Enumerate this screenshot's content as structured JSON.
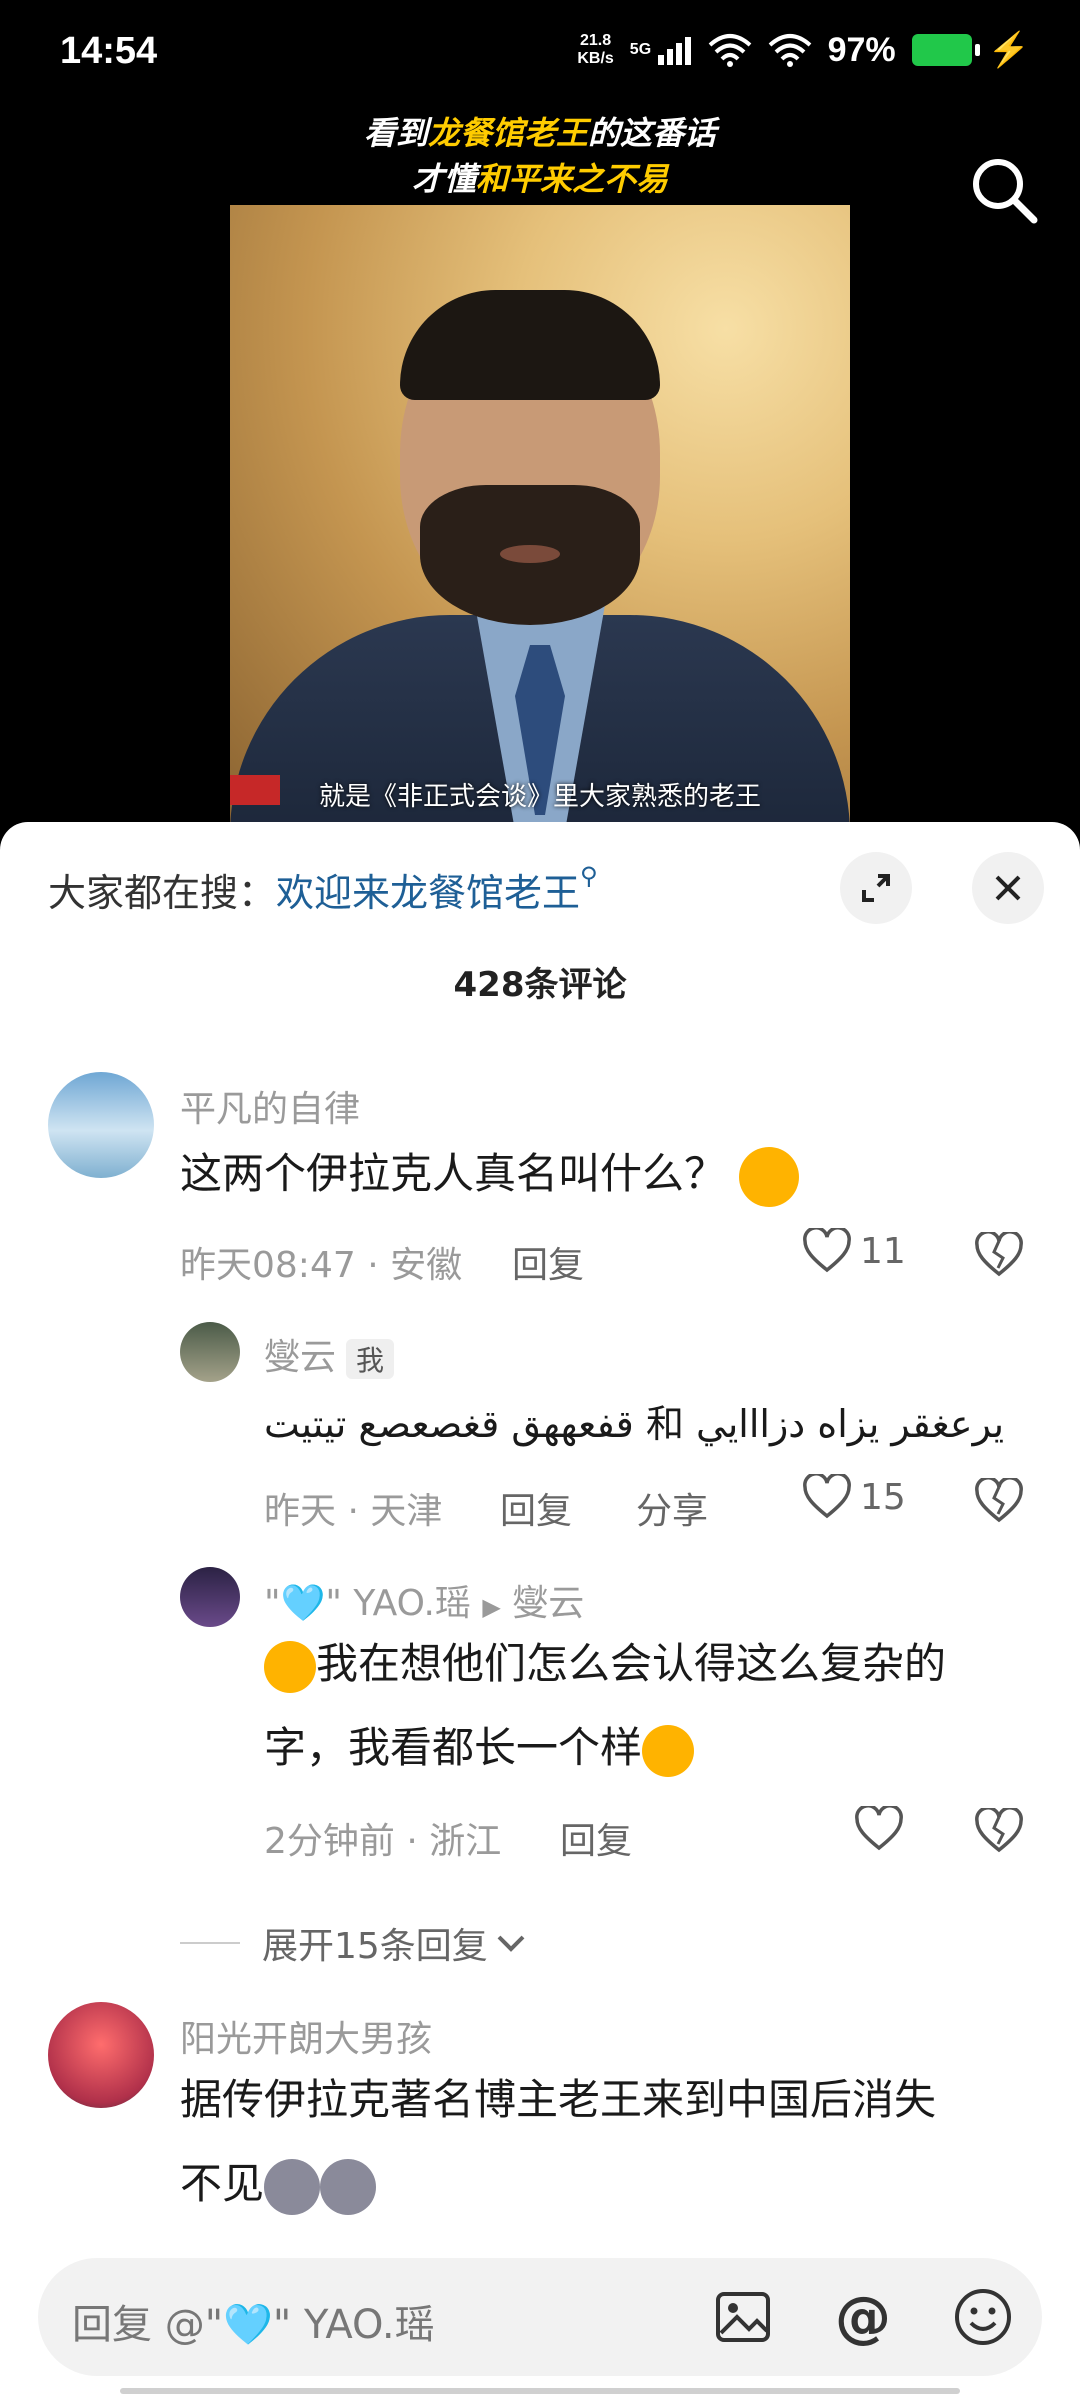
{
  "status_bar": {
    "time": "14:54",
    "net_speed": "21.8",
    "net_unit": "KB/s",
    "signal": "5G",
    "battery_pct": "97%"
  },
  "video": {
    "title_line1_pre": "看到",
    "title_line1_hl": "龙餐馆老王",
    "title_line1_post": "的这番话",
    "title_line2_pre": "才懂",
    "title_line2_hl": "和平来之不易",
    "subtitle": "就是《非正式会谈》里大家熟悉的老王"
  },
  "sheet": {
    "search_label": "大家都在搜：",
    "search_keyword": "欢迎来龙餐馆老王",
    "comment_count": "428条评论"
  },
  "comments": [
    {
      "name": "平凡的自律",
      "text": "这两个伊拉克人真名叫什么？",
      "meta": "昨天08:47 · 安徽",
      "reply": "回复",
      "likes": "11"
    },
    {
      "name": "燮云",
      "badge": "我",
      "text": "قفعههق قغصعصع تيتيت 和 يرعغقر يزاه دزااايي",
      "meta": "昨天 · 天津",
      "reply": "回复",
      "share": "分享",
      "likes": "15"
    },
    {
      "name": "\"🩵\" YAO.瑶",
      "reply_to": "燮云",
      "text_line1": "我在想他们怎么会认得这么复杂的",
      "text_line2": "字，我看都长一个样",
      "meta": "2分钟前 · 浙江",
      "reply": "回复"
    },
    {
      "name": "阳光开朗大男孩",
      "text_line1": "据传伊拉克著名博主老王来到中国后消失",
      "text_line2": "不见"
    }
  ],
  "expand_replies": "展开15条回复",
  "input": {
    "placeholder": "回复 @\"🩵\" YAO.瑶"
  }
}
